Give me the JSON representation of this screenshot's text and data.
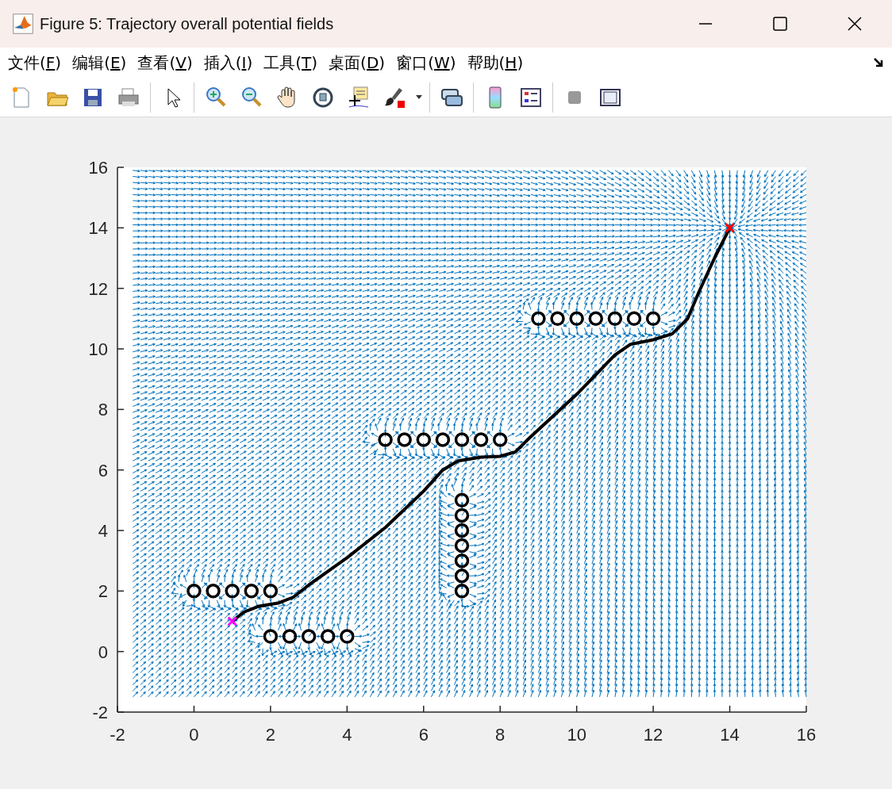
{
  "window": {
    "title": "Figure 5: Trajectory overall potential fields"
  },
  "menu": [
    {
      "before": "文件(",
      "key": "F",
      "after": ")"
    },
    {
      "before": "编辑(",
      "key": "E",
      "after": ")"
    },
    {
      "before": "查看(",
      "key": "V",
      "after": ")"
    },
    {
      "before": "插入(",
      "key": "I",
      "after": ")"
    },
    {
      "before": "工具(",
      "key": "T",
      "after": ")"
    },
    {
      "before": "桌面(",
      "key": "D",
      "after": ")"
    },
    {
      "before": "窗口(",
      "key": "W",
      "after": ")"
    },
    {
      "before": "帮助(",
      "key": "H",
      "after": ")"
    }
  ],
  "plot": {
    "chart_data": {
      "type": "scatter",
      "xlim": [
        -2,
        16
      ],
      "ylim": [
        -2,
        16
      ],
      "xticks": [
        {
          "value": -2,
          "label": "-2"
        },
        {
          "value": 0,
          "label": "0"
        },
        {
          "value": 2,
          "label": "2"
        },
        {
          "value": 4,
          "label": "4"
        },
        {
          "value": 6,
          "label": "6"
        },
        {
          "value": 8,
          "label": "8"
        },
        {
          "value": 10,
          "label": "10"
        },
        {
          "value": 12,
          "label": "12"
        },
        {
          "value": 14,
          "label": "14"
        },
        {
          "value": 16,
          "label": "16"
        }
      ],
      "yticks": [
        {
          "value": -2,
          "label": "-2"
        },
        {
          "value": 0,
          "label": "0"
        },
        {
          "value": 2,
          "label": "2"
        },
        {
          "value": 4,
          "label": "4"
        },
        {
          "value": 6,
          "label": "6"
        },
        {
          "value": 8,
          "label": "8"
        },
        {
          "value": 10,
          "label": "10"
        },
        {
          "value": 12,
          "label": "12"
        },
        {
          "value": 14,
          "label": "14"
        },
        {
          "value": 16,
          "label": "16"
        }
      ],
      "x": [
        9,
        9.5,
        10,
        10.5,
        11,
        11.5,
        12,
        5,
        5.5,
        6,
        6.5,
        7,
        7.5,
        8,
        7,
        7,
        7,
        7,
        7,
        7,
        7,
        0,
        0.5,
        1,
        1.5,
        2,
        2,
        2.5,
        3,
        3.5,
        4,
        1,
        14
      ],
      "series": [
        {
          "color": "#000000",
          "values": [
            11,
            11,
            11,
            11,
            11,
            11,
            11,
            7,
            7,
            7,
            7,
            7,
            7,
            7,
            2,
            2.5,
            3,
            3.5,
            4,
            4.5,
            5,
            2,
            2,
            2,
            2,
            2,
            0.5,
            0.5,
            0.5,
            0.5,
            0.5,
            null,
            null
          ]
        },
        {
          "color": "#ff00ff",
          "values": [
            null,
            null,
            null,
            null,
            null,
            null,
            null,
            null,
            null,
            null,
            null,
            null,
            null,
            null,
            null,
            null,
            null,
            null,
            null,
            null,
            null,
            null,
            null,
            null,
            null,
            null,
            null,
            null,
            null,
            null,
            null,
            1,
            null
          ]
        },
        {
          "color": "#ff0000",
          "values": [
            null,
            null,
            null,
            null,
            null,
            null,
            null,
            null,
            null,
            null,
            null,
            null,
            null,
            null,
            null,
            null,
            null,
            null,
            null,
            null,
            null,
            null,
            null,
            null,
            null,
            null,
            null,
            null,
            null,
            null,
            null,
            null,
            14
          ]
        }
      ]
    }
  }
}
